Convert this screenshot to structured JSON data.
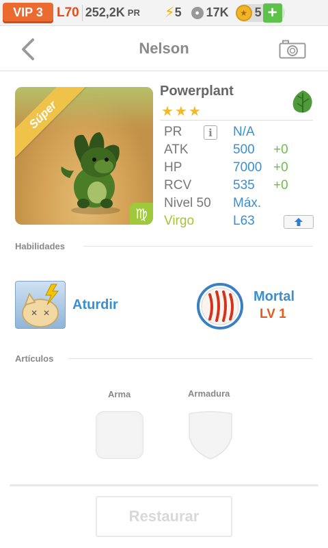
{
  "status_bar": {
    "vip": "VIP 3",
    "level": "L70",
    "power": "252,2K",
    "power_unit": "PR",
    "energy": "5",
    "food": "17K",
    "coins": "5",
    "add_label": "+"
  },
  "header": {
    "title": "Nelson",
    "back_icon": "chevron-left-icon",
    "camera_icon": "camera-icon"
  },
  "monster": {
    "name": "Powerplant",
    "stars": "★★★",
    "badge": "Súper",
    "element_icon": "leaf-icon",
    "sign_glyph": "♍",
    "stats": {
      "pr_label": "PR",
      "pr_value": "N/A",
      "atk_label": "ATK",
      "atk_value": "500",
      "atk_bonus": "+0",
      "hp_label": "HP",
      "hp_value": "7000",
      "hp_bonus": "+0",
      "rcv_label": "RCV",
      "rcv_value": "535",
      "rcv_bonus": "+0",
      "level_label": "Nivel 50",
      "level_value": "Máx.",
      "sign_label": "Virgo",
      "sign_value": "L63"
    },
    "colors": {
      "stat_value": "#3a8fd0",
      "bonus": "#6cc04a",
      "sign": "#a3c436"
    }
  },
  "skills": {
    "section_label": "Habilidades",
    "active": {
      "name": "Aturdir",
      "icon": "stun-icon"
    },
    "passive": {
      "name": "Mortal",
      "level": "LV 1",
      "icon": "claw-icon"
    }
  },
  "items": {
    "section_label": "Artículos",
    "weapon_label": "Arma",
    "armor_label": "Armadura"
  },
  "actions": {
    "restore": "Restaurar"
  }
}
